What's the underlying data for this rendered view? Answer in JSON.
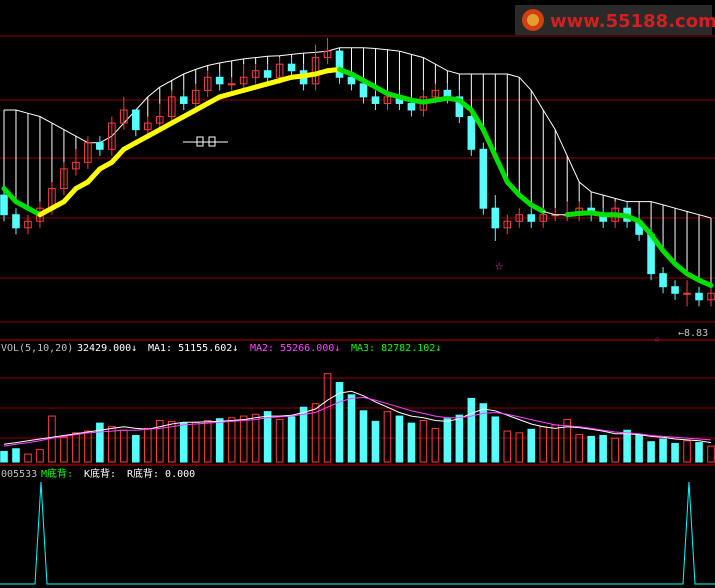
{
  "watermark": {
    "text": "www.55188.com"
  },
  "colors": {
    "up": "#ff3c3c",
    "down": "#54ffff",
    "background": "#000000",
    "grid": "#8b0000",
    "white": "#ffffff",
    "yellow": "#ffff00",
    "green": "#00e000",
    "magenta": "#ff44ff",
    "lime": "#00ff00",
    "cyan": "#00ffff"
  },
  "panels": {
    "vol": {
      "name": "VOL(5,10,20)",
      "value": "32429.000↓",
      "ma1": "MA1: 51155.602↓",
      "ma2": "MA2: 55266.000↓",
      "ma3": "MA3: 82782.102↓"
    },
    "ind": {
      "name": "005533",
      "m": "M底背:",
      "k": "K底背:",
      "r": "R底背: 0.000"
    }
  },
  "annotations": {
    "price_label": "←8.83"
  },
  "chart_data": [
    {
      "type": "candlestick",
      "count": 60,
      "ylim": [
        8.8,
        13.2
      ],
      "open": [
        10.8,
        10.5,
        10.3,
        10.4,
        10.6,
        10.9,
        11.2,
        11.3,
        11.6,
        11.5,
        11.9,
        12.1,
        11.8,
        11.9,
        12.0,
        12.3,
        12.2,
        12.4,
        12.6,
        12.5,
        12.5,
        12.6,
        12.7,
        12.6,
        12.8,
        12.7,
        12.5,
        12.9,
        13.0,
        12.6,
        12.5,
        12.3,
        12.2,
        12.3,
        12.2,
        12.1,
        12.3,
        12.4,
        12.3,
        12.0,
        11.5,
        10.6,
        10.3,
        10.4,
        10.5,
        10.4,
        10.5,
        10.5,
        10.5,
        10.6,
        10.5,
        10.4,
        10.6,
        10.4,
        10.2,
        9.6,
        9.4,
        9.3,
        9.3,
        9.2
      ],
      "close": [
        10.5,
        10.3,
        10.4,
        10.6,
        10.9,
        11.2,
        11.3,
        11.6,
        11.5,
        11.9,
        12.1,
        11.8,
        11.9,
        12.0,
        12.3,
        12.2,
        12.4,
        12.6,
        12.5,
        12.5,
        12.6,
        12.7,
        12.6,
        12.8,
        12.7,
        12.5,
        12.9,
        13.0,
        12.6,
        12.5,
        12.3,
        12.2,
        12.3,
        12.2,
        12.1,
        12.3,
        12.4,
        12.3,
        12.0,
        11.5,
        10.6,
        10.3,
        10.4,
        10.5,
        10.4,
        10.5,
        10.5,
        10.5,
        10.6,
        10.5,
        10.4,
        10.6,
        10.4,
        10.2,
        9.6,
        9.4,
        9.3,
        9.3,
        9.2,
        9.3
      ],
      "high": [
        10.9,
        10.6,
        10.5,
        10.7,
        11.0,
        11.3,
        11.5,
        11.7,
        11.7,
        12.0,
        12.3,
        12.1,
        12.0,
        12.2,
        12.4,
        12.4,
        12.5,
        12.7,
        12.7,
        12.6,
        12.8,
        12.8,
        12.8,
        12.9,
        12.9,
        12.8,
        13.1,
        13.2,
        13.0,
        12.7,
        12.6,
        12.4,
        12.4,
        12.4,
        12.3,
        12.4,
        12.5,
        12.5,
        12.4,
        12.1,
        11.6,
        10.8,
        10.5,
        10.6,
        10.6,
        10.6,
        10.6,
        10.7,
        10.7,
        10.7,
        10.6,
        10.7,
        10.7,
        10.5,
        10.3,
        9.7,
        9.5,
        9.5,
        9.4,
        9.4
      ],
      "low": [
        10.4,
        10.2,
        10.2,
        10.3,
        10.5,
        10.8,
        11.1,
        11.2,
        11.4,
        11.4,
        11.8,
        11.7,
        11.7,
        11.8,
        11.9,
        12.1,
        12.1,
        12.3,
        12.4,
        12.4,
        12.4,
        12.5,
        12.5,
        12.5,
        12.6,
        12.4,
        12.4,
        12.8,
        12.5,
        12.4,
        12.2,
        12.1,
        12.1,
        12.1,
        12.0,
        12.0,
        12.2,
        12.2,
        11.9,
        11.4,
        10.5,
        10.1,
        10.2,
        10.3,
        10.3,
        10.3,
        10.4,
        10.4,
        10.4,
        10.4,
        10.3,
        10.3,
        10.3,
        10.1,
        9.5,
        9.3,
        9.2,
        9.1,
        9.1,
        9.1
      ],
      "ma_line": [
        10.9,
        10.7,
        10.6,
        10.5,
        10.6,
        10.7,
        10.9,
        11.0,
        11.2,
        11.3,
        11.5,
        11.6,
        11.7,
        11.8,
        11.9,
        12.0,
        12.1,
        12.2,
        12.3,
        12.35,
        12.4,
        12.45,
        12.5,
        12.55,
        12.6,
        12.62,
        12.65,
        12.7,
        12.72,
        12.65,
        12.55,
        12.45,
        12.35,
        12.3,
        12.25,
        12.22,
        12.25,
        12.28,
        12.25,
        12.1,
        11.8,
        11.4,
        11.0,
        10.8,
        10.65,
        10.55,
        10.5,
        10.5,
        10.52,
        10.53,
        10.5,
        10.5,
        10.48,
        10.4,
        10.2,
        9.95,
        9.75,
        9.6,
        9.5,
        9.42
      ],
      "cloud_top": [
        12.1,
        12.1,
        12.05,
        12.0,
        11.9,
        11.8,
        11.7,
        11.6,
        11.6,
        11.7,
        11.9,
        12.1,
        12.3,
        12.45,
        12.55,
        12.65,
        12.72,
        12.78,
        12.82,
        12.85,
        12.88,
        12.9,
        12.92,
        12.93,
        12.95,
        12.97,
        12.98,
        13.0,
        13.05,
        13.05,
        13.05,
        13.04,
        13.02,
        13.0,
        12.95,
        12.9,
        12.8,
        12.7,
        12.65,
        12.65,
        12.65,
        12.65,
        12.65,
        12.6,
        12.4,
        12.1,
        11.8,
        11.4,
        11.0,
        10.85,
        10.8,
        10.75,
        10.7,
        10.7,
        10.7,
        10.65,
        10.6,
        10.55,
        10.5,
        10.45
      ],
      "ma_color": [
        "green",
        "green",
        "green",
        "yellow",
        "yellow",
        "yellow",
        "yellow",
        "yellow",
        "yellow",
        "yellow",
        "yellow",
        "yellow",
        "yellow",
        "yellow",
        "yellow",
        "yellow",
        "yellow",
        "yellow",
        "yellow",
        "yellow",
        "yellow",
        "yellow",
        "yellow",
        "yellow",
        "yellow",
        "yellow",
        "yellow",
        "yellow",
        "green",
        "green",
        "green",
        "green",
        "green",
        "green",
        "green",
        "green",
        "green",
        "green",
        "green",
        "green",
        "green",
        "green",
        "green",
        "green",
        "green",
        "white",
        "white",
        "green",
        "green",
        "green",
        "green",
        "green",
        "green",
        "green",
        "green",
        "green",
        "green",
        "green",
        "green",
        "green"
      ]
    },
    {
      "type": "bar",
      "name": "VOL(5,10,20)",
      "ylim": [
        0,
        120000
      ],
      "values": [
        12000,
        15000,
        9000,
        14000,
        52000,
        28000,
        33000,
        35000,
        44000,
        40000,
        36000,
        30000,
        38000,
        47000,
        46000,
        44000,
        45000,
        47000,
        49000,
        50000,
        52000,
        54000,
        57000,
        48000,
        51000,
        62000,
        66000,
        100000,
        90000,
        76000,
        58000,
        46000,
        57000,
        52000,
        44000,
        47000,
        38000,
        49000,
        53000,
        72000,
        66000,
        51000,
        35000,
        33000,
        37000,
        40000,
        42000,
        48000,
        31000,
        29000,
        30000,
        27000,
        36000,
        31000,
        23000,
        26000,
        21000,
        24000,
        22000,
        18000
      ],
      "ma1": [
        20000,
        22000,
        24000,
        26000,
        28000,
        30000,
        32000,
        34000,
        36000,
        38000,
        40000,
        38000,
        37000,
        40000,
        43000,
        45000,
        45000,
        45500,
        46000,
        47000,
        48000,
        50000,
        52000,
        52000,
        53000,
        56000,
        60000,
        70000,
        78000,
        80000,
        75000,
        68000,
        62000,
        56000,
        52000,
        50000,
        47000,
        46000,
        49000,
        55000,
        60000,
        58000,
        53000,
        48000,
        43000,
        40000,
        38000,
        40000,
        39000,
        37000,
        35000,
        32000,
        32000,
        31000,
        29000,
        28000,
        26000,
        25000,
        24000,
        22000
      ],
      "ma2": [
        18000,
        20000,
        22000,
        24000,
        27000,
        29000,
        31000,
        33000,
        34000,
        35000,
        36000,
        36000,
        37000,
        38000,
        40000,
        42000,
        43000,
        44000,
        45000,
        46000,
        47000,
        48000,
        50000,
        51000,
        52000,
        54000,
        56000,
        62000,
        68000,
        72000,
        73000,
        70000,
        66000,
        62000,
        58000,
        55000,
        52000,
        50000,
        50000,
        52000,
        55000,
        56000,
        54000,
        51000,
        48000,
        45000,
        42000,
        41000,
        40000,
        38000,
        36000,
        34000,
        33000,
        32000,
        30000,
        29000,
        28000,
        27000,
        26000,
        25000
      ]
    },
    {
      "type": "line",
      "name": "005533",
      "ylim": [
        0,
        1
      ],
      "values": [
        0,
        0,
        0,
        0,
        0,
        0,
        0,
        0,
        0,
        0,
        0,
        0,
        0,
        0,
        0,
        0,
        0,
        0,
        0,
        0,
        0,
        0,
        0,
        0,
        0,
        0,
        0,
        0,
        0,
        0,
        0,
        0,
        0,
        0,
        0,
        0,
        0,
        0,
        0,
        0,
        0,
        0,
        0,
        0,
        0,
        0,
        0,
        0,
        0,
        0,
        0,
        0,
        0,
        0,
        0,
        0,
        0,
        1,
        0,
        0
      ],
      "peak_index": [
        1,
        57
      ]
    }
  ]
}
